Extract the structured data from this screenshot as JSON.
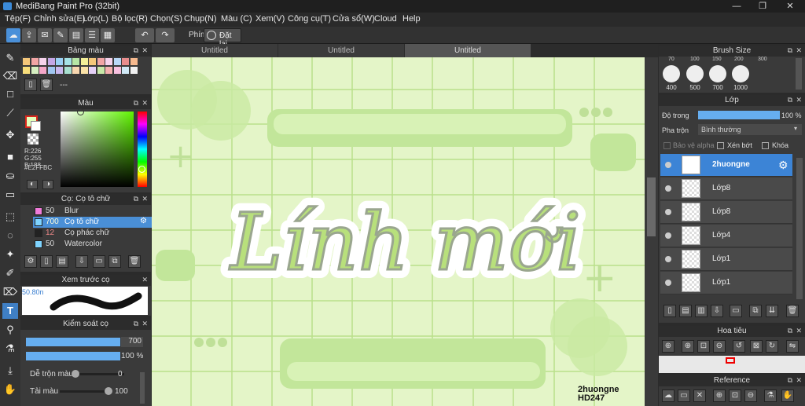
{
  "title": "MediBang Paint Pro (32bit)",
  "window_controls": [
    "—",
    "❐",
    "✕"
  ],
  "menu": [
    "Tệp(F)",
    "Chỉnh sửa(E)",
    "Lớp(L)",
    "Bộ lọc(R)",
    "Chọn(S)",
    "Chụp(N)",
    "Màu (C)",
    "Xem(V)",
    "Công cụ(T)",
    "Cửa sổ(W)",
    "Cloud",
    "Help"
  ],
  "toolbar": {
    "keys_label": "Phím",
    "reset_label": "Đặt lại"
  },
  "palette": {
    "title": "Bảng màu",
    "colors": [
      "#f4c77a",
      "#f1a5a5",
      "#f6d3ec",
      "#c4a7e6",
      "#9ad0f5",
      "#a5e3e6",
      "#b6e6a5",
      "#f4f098",
      "#f4c77a",
      "#f1a5a5",
      "#f6d3ec",
      "#b9d8f7",
      "#e88e8e",
      "#f6b98e",
      "#f8de7b",
      "#d6efc1",
      "#f4a6c8",
      "#a0c6f0",
      "#c9b8ee",
      "#a8e0d0",
      "#f7d7b0",
      "#fbe3a7",
      "#e5d0f7",
      "#c8e8a8",
      "#f4b0b0",
      "#f7c0df",
      "#d1eaf7",
      "#f1f1f1"
    ],
    "bottom_text": "---"
  },
  "color": {
    "title": "Màu",
    "r": "R:226",
    "g": "G:255",
    "b": "B:188",
    "hex": "#E2FFBC",
    "primary": "#E2FFBC"
  },
  "brush": {
    "title": "Cọ: Cọ tô chữ",
    "items": [
      {
        "size": "50",
        "name": "Blur",
        "color": "#f07bd9"
      },
      {
        "size": "700",
        "name": "Cọ tô chữ",
        "color": "#7fd4ff"
      },
      {
        "size": "12",
        "name": "Cọ phác chữ",
        "color": "#222222"
      },
      {
        "size": "50",
        "name": "Watercolor",
        "color": "#7fd4ff"
      }
    ]
  },
  "preview": {
    "title": "Xem trước cọ",
    "size": "50.80n"
  },
  "brush_control": {
    "title": "Kiểm soát cọ",
    "width_value": "700",
    "opacity_value": "100 %",
    "blend_label": "Dễ trộn màu",
    "blend_value": "0",
    "load_label": "Tải màu",
    "load_value": "100",
    "width_fill": 1.0,
    "opacity_fill": 1.0,
    "blend_fill": 0.0,
    "load_fill": 1.0
  },
  "tabs": [
    "Untitled",
    "Untitled",
    "Untitled"
  ],
  "canvas": {
    "main_text": "Lính mới",
    "watermark1": "2huongne",
    "watermark2": "HD247"
  },
  "brush_size": {
    "title": "Brush Size",
    "top_values": [
      "70",
      "100",
      "150",
      "200",
      "300"
    ],
    "bottom_values": [
      "400",
      "500",
      "700",
      "1000"
    ]
  },
  "layers": {
    "title": "Lớp",
    "opacity_label": "Độ trong",
    "opacity_value": "100 %",
    "opacity_fill": 1.0,
    "blend_label": "Pha trộn",
    "blend_mode": "Bình thường",
    "alpha_label": "Bảo vệ alpha",
    "clip_label": "Xén bớt",
    "lock_label": "Khóa",
    "items": [
      {
        "name": "2huongne",
        "active": true
      },
      {
        "name": "Lớp8",
        "active": false
      },
      {
        "name": "Lớp8",
        "active": false
      },
      {
        "name": "Lớp4",
        "active": false
      },
      {
        "name": "Lớp1",
        "active": false
      },
      {
        "name": "Lớp1",
        "active": false
      }
    ]
  },
  "navigator": {
    "title": "Hoa tiêu"
  },
  "reference": {
    "title": "Reference"
  }
}
